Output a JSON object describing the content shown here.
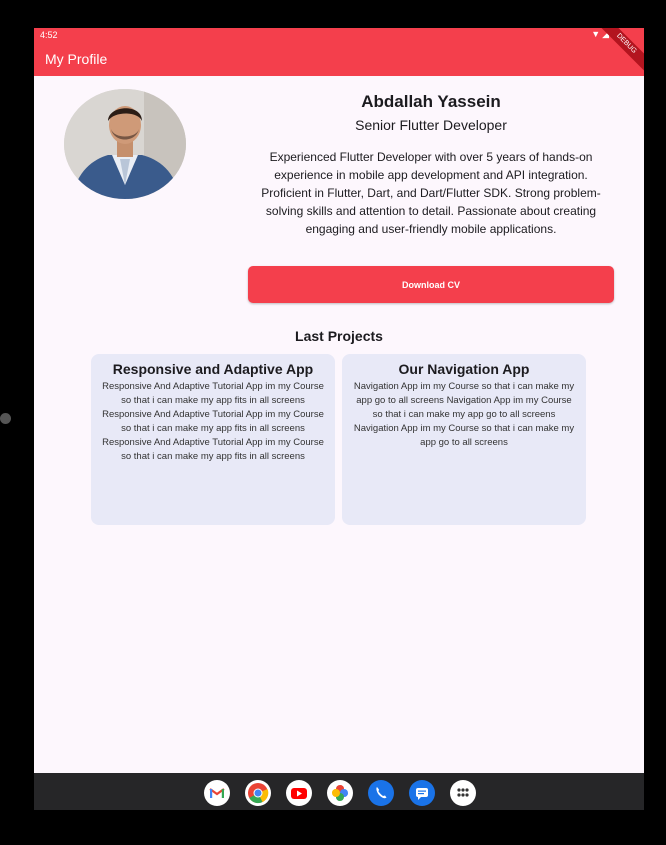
{
  "status_bar": {
    "time": "4:52",
    "icons": "▼◢▮"
  },
  "app_bar": {
    "title": "My Profile",
    "debug_banner": "DEBUG"
  },
  "profile": {
    "name": "Abdallah Yassein",
    "role": "Senior Flutter Developer",
    "bio": "Experienced Flutter Developer with over 5 years of hands-on experience in mobile app development and API integration. Proficient in Flutter, Dart, and Dart/Flutter SDK. Strong problem-solving skills and attention to detail. Passionate about creating engaging and user-friendly mobile applications.",
    "download_button": "Download CV"
  },
  "projects": {
    "heading": "Last Projects",
    "items": [
      {
        "title": "Responsive and Adaptive App",
        "description": "Responsive And Adaptive Tutorial App im my Course so that i can make my app fits in all screens Responsive And Adaptive Tutorial App im my Course so that i can make my app fits in all screens Responsive And Adaptive Tutorial App im my Course so that i can make my app fits in all screens"
      },
      {
        "title": "Our Navigation App",
        "description": "Navigation App im my Course so that i can make my app go to all screens Navigation App im my Course so that i can make my app go to all screens Navigation App im my Course so that i can make my app go to all screens"
      }
    ]
  },
  "dock": {
    "apps": [
      "gmail-icon",
      "chrome-icon",
      "youtube-icon",
      "photos-icon",
      "phone-icon",
      "messages-icon",
      "app-drawer-icon"
    ]
  },
  "colors": {
    "primary": "#f43f4c",
    "background": "#fdf7fd",
    "card": "#e8e9f7",
    "text": "#1c1b1f"
  }
}
